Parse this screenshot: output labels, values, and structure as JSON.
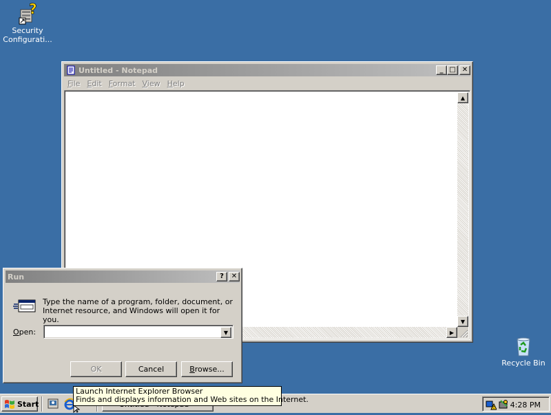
{
  "desktop": {
    "background_color": "#3a6ea5",
    "icons": [
      {
        "label": "Security Configurati...",
        "icon": "security-config-icon"
      },
      {
        "label": "Recycle Bin",
        "icon": "recycle-bin-icon"
      }
    ]
  },
  "notepad": {
    "title": "Untitled - Notepad",
    "menus": [
      {
        "accel": "F",
        "rest": "ile"
      },
      {
        "accel": "E",
        "rest": "dit"
      },
      {
        "accel": "F",
        "rest": "ormat"
      },
      {
        "accel": "V",
        "rest": "iew"
      },
      {
        "accel": "H",
        "rest": "elp"
      }
    ],
    "content": "",
    "controls": {
      "minimize": "_",
      "maximize": "□",
      "close": "✕"
    }
  },
  "run_dialog": {
    "title": "Run",
    "description": "Type the name of a program, folder, document, or Internet resource, and Windows will open it for you.",
    "open_label_accel": "O",
    "open_label_rest": "pen:",
    "open_value": "",
    "help": "?",
    "close": "✕",
    "buttons": {
      "ok": "OK",
      "cancel": "Cancel",
      "browse_accel": "B",
      "browse_rest": "rowse..."
    }
  },
  "taskbar": {
    "start_label": "Start",
    "task_button_label": "Untitled - Notepad",
    "clock": "4:28 PM"
  },
  "tooltip": {
    "line1": "Launch Internet Explorer Browser",
    "line2": "Finds and displays information and Web sites on the Internet."
  },
  "colors": {
    "active_title_from": "#0a246a",
    "active_title_to": "#a6caf0",
    "inactive_title_from": "#808080",
    "inactive_title_to": "#c0c0c0",
    "face": "#d4d0c8",
    "tooltip_bg": "#ffffe1"
  }
}
